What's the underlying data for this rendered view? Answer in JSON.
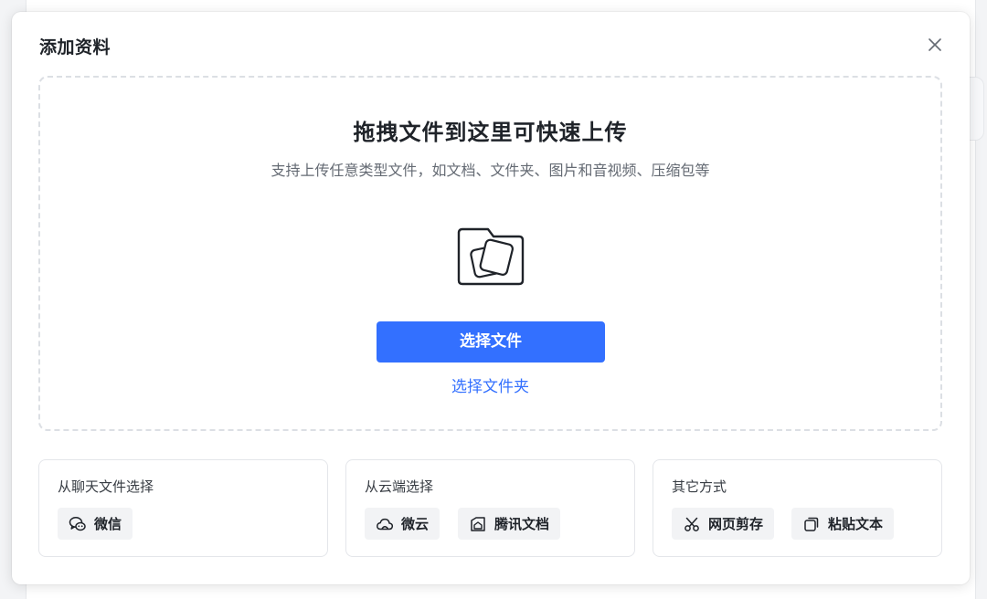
{
  "modal": {
    "title": "添加资料",
    "close_icon": "close-icon"
  },
  "dropzone": {
    "title": "拖拽文件到这里可快速上传",
    "subtitle": "支持上传任意类型文件，如文档、文件夹、图片和音视频、压缩包等",
    "icon": "folder-files-icon",
    "select_file_label": "选择文件",
    "select_folder_label": "选择文件夹"
  },
  "sources": [
    {
      "title": "从聊天文件选择",
      "options": [
        {
          "label": "微信",
          "icon": "wechat-icon"
        }
      ]
    },
    {
      "title": "从云端选择",
      "options": [
        {
          "label": "微云",
          "icon": "cloud-icon"
        },
        {
          "label": "腾讯文档",
          "icon": "tencent-docs-icon"
        }
      ]
    },
    {
      "title": "其它方式",
      "options": [
        {
          "label": "网页剪存",
          "icon": "scissors-icon"
        },
        {
          "label": "粘贴文本",
          "icon": "paste-icon"
        }
      ]
    }
  ],
  "colors": {
    "accent": "#3370ff",
    "chip_bg": "#f2f3f5",
    "border": "#e4e6ea"
  }
}
